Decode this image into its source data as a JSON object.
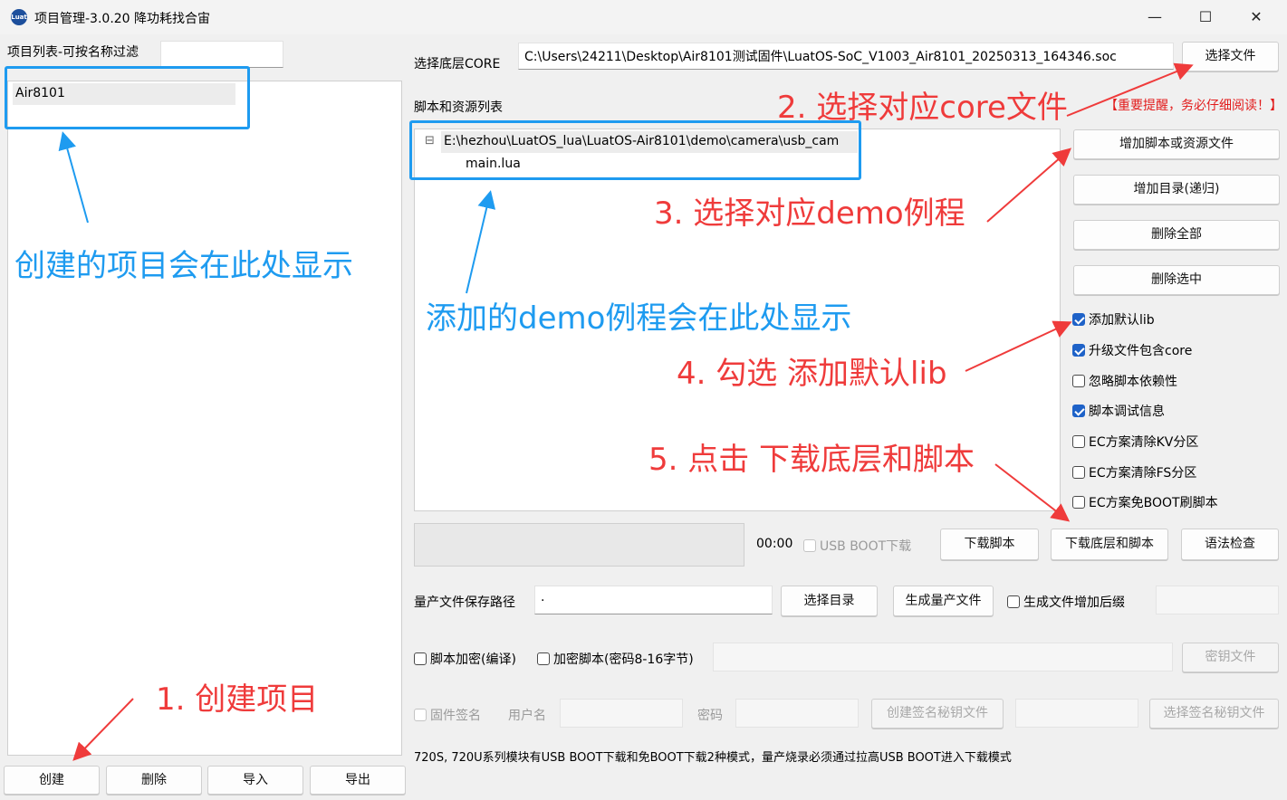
{
  "window": {
    "title": "项目管理-3.0.20 降功耗找合宙",
    "icon_text": "Luat",
    "controls": {
      "minimize": "—",
      "maximize": "☐",
      "close": "✕"
    }
  },
  "left": {
    "filter_label": "项目列表-可按名称过滤",
    "filter_value": "",
    "projects": [
      "Air8101"
    ],
    "buttons": {
      "create": "创建",
      "delete": "删除",
      "import": "导入",
      "export": "导出"
    }
  },
  "core": {
    "label": "选择底层CORE",
    "path": "C:\\Users\\24211\\Desktop\\Air8101测试固件\\LuatOS-SoC_V1003_Air8101_20250313_164346.soc",
    "select_button": "选择文件"
  },
  "scripts": {
    "label": "脚本和资源列表",
    "warning": "【重要提醒，务必仔细阅读！】",
    "tree": {
      "expander": "⊟",
      "root": "E:\\hezhou\\LuatOS_lua\\LuatOS-Air8101\\demo\\camera\\usb_cam",
      "children": [
        "main.lua"
      ]
    },
    "buttons": {
      "add_file": "增加脚本或资源文件",
      "add_dir": "增加目录(递归)",
      "delete_all": "删除全部",
      "delete_selected": "删除选中"
    }
  },
  "options": [
    {
      "label": "添加默认lib",
      "checked": true
    },
    {
      "label": "升级文件包含core",
      "checked": true
    },
    {
      "label": "忽略脚本依赖性",
      "checked": false
    },
    {
      "label": "脚本调试信息",
      "checked": true
    },
    {
      "label": "EC方案清除KV分区",
      "checked": false
    },
    {
      "label": "EC方案清除FS分区",
      "checked": false
    },
    {
      "label": "EC方案免BOOT刷脚本",
      "checked": false
    }
  ],
  "download": {
    "time": "00:00",
    "usb_boot": "USB BOOT下载",
    "download_script": "下载脚本",
    "download_core_script": "下载底层和脚本",
    "syntax_check": "语法检查"
  },
  "mass": {
    "path_label": "量产文件保存路径",
    "path_value": ".",
    "select_dir": "选择目录",
    "generate": "生成量产文件",
    "add_suffix": "生成文件增加后缀",
    "suffix_value": ""
  },
  "encrypt": {
    "compile": "脚本加密(编译)",
    "encrypt": "加密脚本(密码8-16字节)",
    "key_value": "",
    "key_file": "密钥文件"
  },
  "sign": {
    "firmware_sign": "固件签名",
    "username_label": "用户名",
    "username_value": "",
    "password_label": "密码",
    "password_value": "",
    "create_key": "创建签名秘钥文件",
    "key_path": "",
    "select_key": "选择签名秘钥文件"
  },
  "note": "720S, 720U系列模块有USB BOOT下载和免BOOT下载2种模式，量产烧录必须通过拉高USB BOOT进入下载模式",
  "annotations": {
    "project_shown": "创建的项目会在此处显示",
    "demo_shown": "添加的demo例程会在此处显示",
    "step1": "1. 创建项目",
    "step2": "2. 选择对应core文件",
    "step3": "3. 选择对应demo例程",
    "step4": "4. 勾选 添加默认lib",
    "step5": "5. 点击 下载底层和脚本"
  },
  "colors": {
    "annotation_blue": "#1e9bf0",
    "annotation_red": "#ef3b3b",
    "check_blue": "#1e62c8",
    "warning_red": "#e21b1b"
  }
}
